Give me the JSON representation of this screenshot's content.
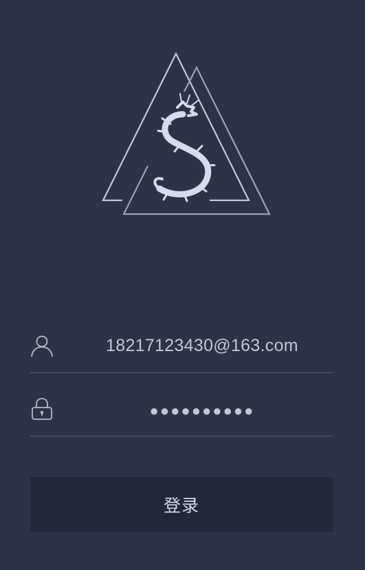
{
  "login_form": {
    "username_value": "18217123430@163.com",
    "password_masked": "●●●●●●●●●●",
    "login_label": "登录"
  },
  "icons": {
    "logo": "dragon-triangle-logo",
    "username": "user-icon",
    "password": "lock-icon"
  },
  "colors": {
    "background": "#2d3245",
    "button_background": "#232838",
    "divider": "#5b6072",
    "text": "#c3c7d2"
  }
}
